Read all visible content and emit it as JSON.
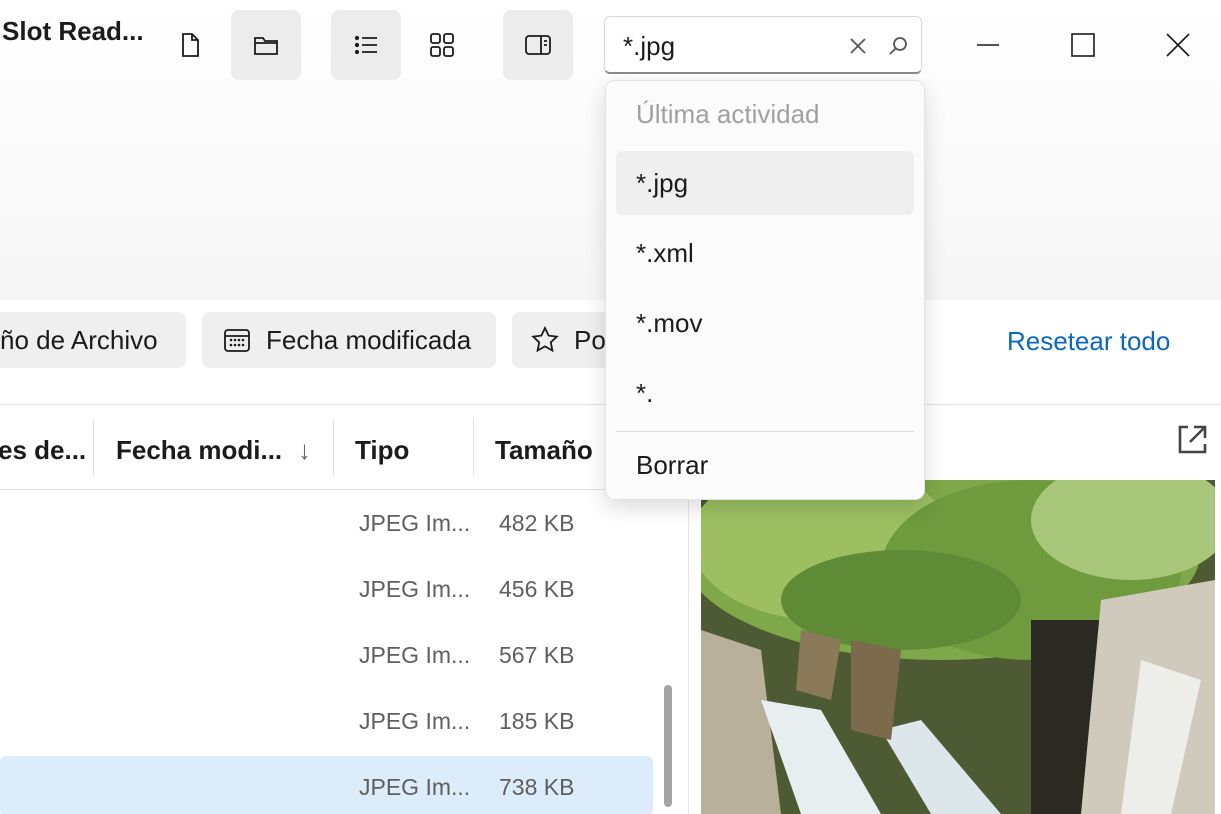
{
  "app": {
    "title": "Slot Read..."
  },
  "toolbar": {
    "icons": [
      "new-file-icon",
      "folder-icon",
      "list-view-icon",
      "grid-view-icon",
      "preview-pane-icon"
    ]
  },
  "search": {
    "value": "*.jpg"
  },
  "window_controls": [
    "minimize-icon",
    "maximize-icon",
    "close-icon"
  ],
  "filters": {
    "chip1_label": "ño de Archivo",
    "chip2_label": "Fecha modificada",
    "chip3_label": "Po",
    "reset_label": "Resetear todo"
  },
  "table": {
    "columns": [
      "es de...",
      "Fecha modi...",
      "Tipo",
      "Tamaño"
    ],
    "sort_indicator": "↓",
    "rows": [
      {
        "tipo": "JPEG Im...",
        "size": "482 KB"
      },
      {
        "tipo": "JPEG Im...",
        "size": "456 KB"
      },
      {
        "tipo": "JPEG Im...",
        "size": "567 KB"
      },
      {
        "tipo": "JPEG Im...",
        "size": "185 KB"
      },
      {
        "tipo": "JPEG Im...",
        "size": "738 KB"
      }
    ]
  },
  "dropdown": {
    "header": "Última actividad",
    "items": [
      "*.jpg",
      "*.xml",
      "*.mov",
      "*."
    ],
    "clear_label": "Borrar"
  },
  "colors": {
    "accent": "#0a67c2",
    "selected_row": "#dcecfb"
  }
}
